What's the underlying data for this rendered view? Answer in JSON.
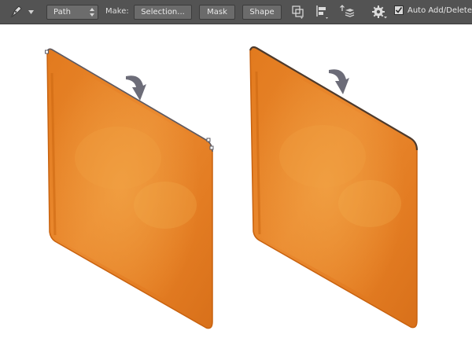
{
  "options_bar": {
    "tool_icon": "pen-tool-icon",
    "mode": "Path",
    "make_label": "Make:",
    "buttons": {
      "selection": "Selection...",
      "mask": "Mask",
      "shape": "Shape"
    },
    "icons": [
      "path-operations-icon",
      "path-alignment-icon",
      "path-arrangement-icon",
      "gear-icon"
    ],
    "auto_add_delete": {
      "label": "Auto Add/Delete",
      "checked": true
    }
  },
  "canvas": {
    "illustrations": [
      {
        "name": "orange-panel-before",
        "fill": "#e47f24"
      },
      {
        "name": "orange-panel-after",
        "fill": "#e47f24"
      }
    ],
    "colors": {
      "panel_edge": "#c8620f",
      "panel_highlight": "#f0a545",
      "path_outline": "#5b5b66",
      "arrow": "#6c6c78"
    }
  }
}
